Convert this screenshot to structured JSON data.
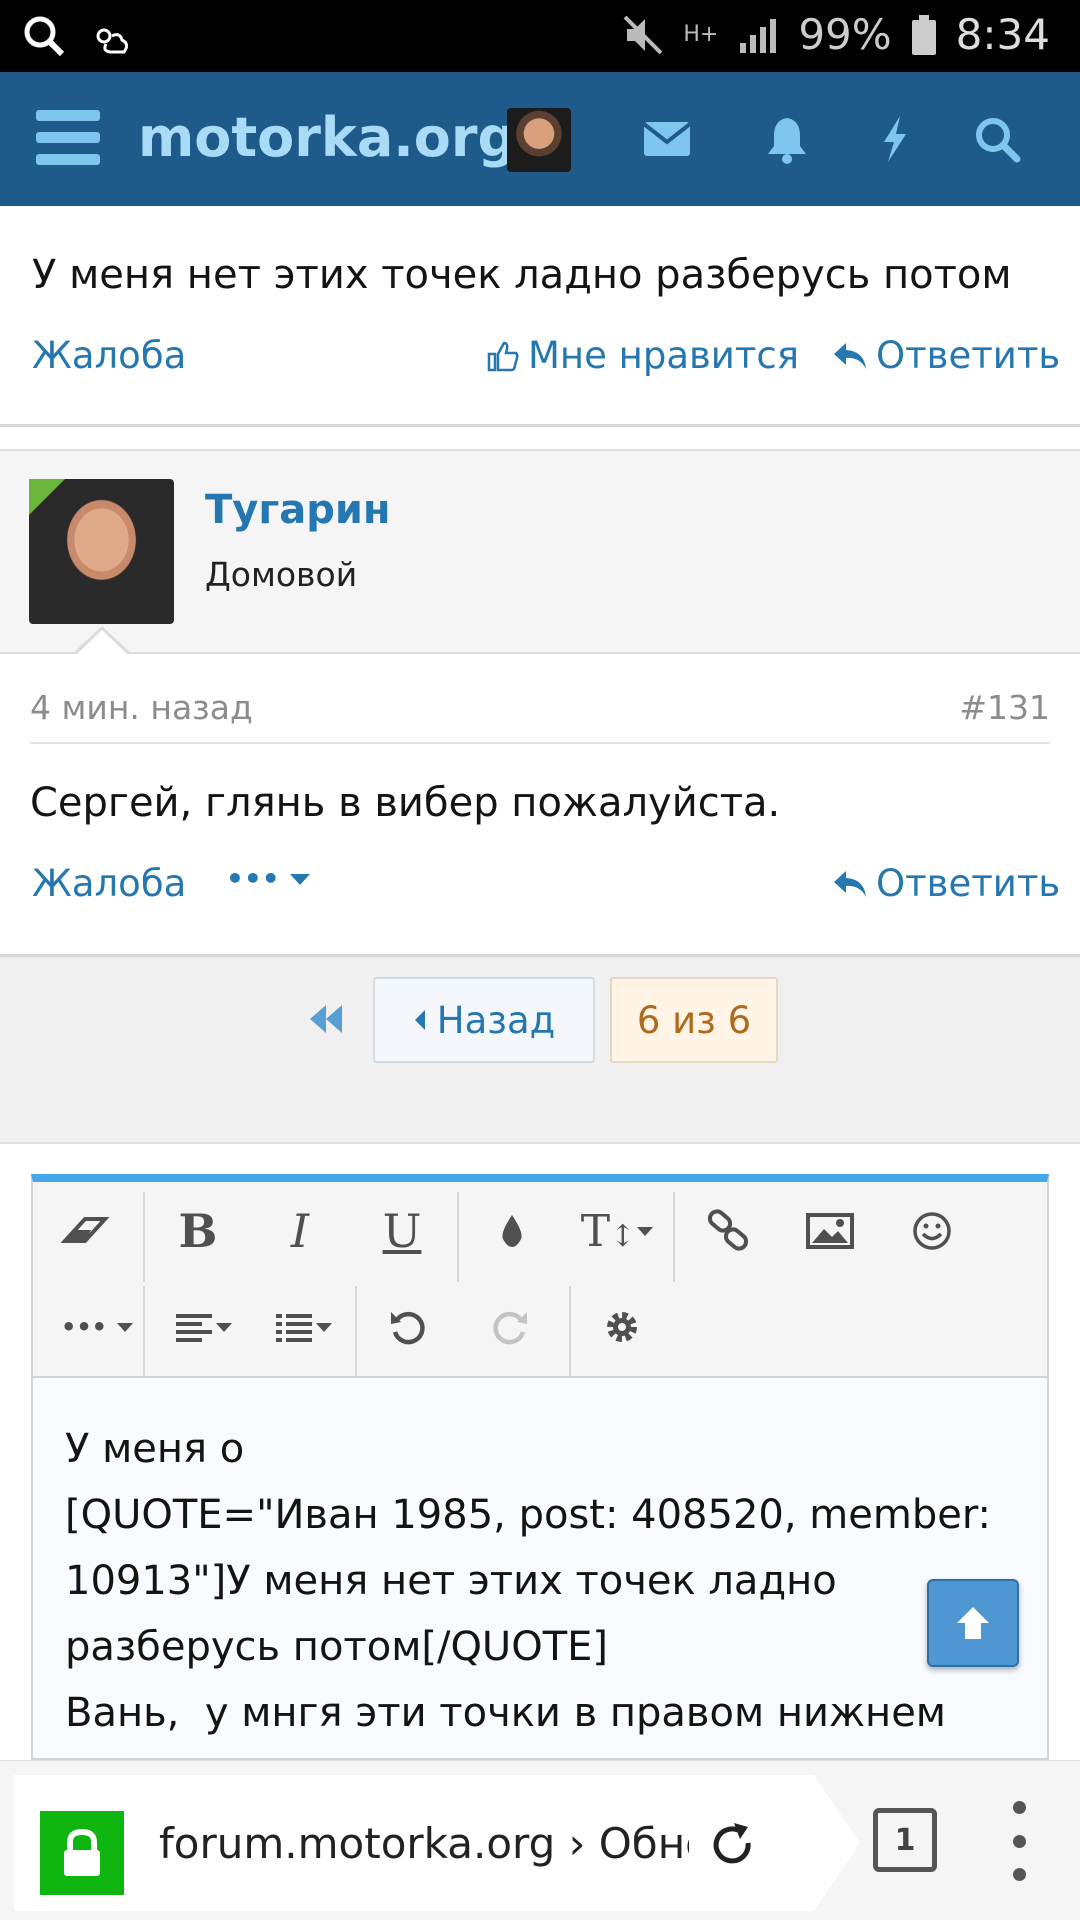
{
  "status_bar": {
    "network": "H+",
    "battery": "99%",
    "time": "8:34"
  },
  "header": {
    "brand": "motorka.org"
  },
  "post_previous": {
    "text": "У меня нет этих точек ладно разберусь потом",
    "report_label": "Жалоба",
    "like_label": "Мне нравится",
    "reply_label": "Ответить"
  },
  "post": {
    "author": "Тугарин",
    "user_title": "Домовой",
    "time": "4 мин. назад",
    "number": "#131",
    "text": "Сергей, глянь в вибер пожалуйста.",
    "report_label": "Жалоба",
    "more_label": "•••",
    "reply_label": "Ответить"
  },
  "pagination": {
    "prev_label": "Назад",
    "current": "6 из 6"
  },
  "editor": {
    "content": "У меня о\n[QUOTE=\"Иван 1985, post: 408520, member: 10913\"]У меня нет этих точек ладно разберусь потом[/QUOTE]\nВань,  у мнгя эти точки в правом нижнем"
  },
  "browser": {
    "url": "forum.motorka.org › Обно",
    "tab_count": "1"
  },
  "colors": {
    "header_bg": "#1e5a8a",
    "brand": "#a9dbf6",
    "link": "#2577b1",
    "editor_accent": "#47a7eb",
    "lock": "#10b610"
  }
}
